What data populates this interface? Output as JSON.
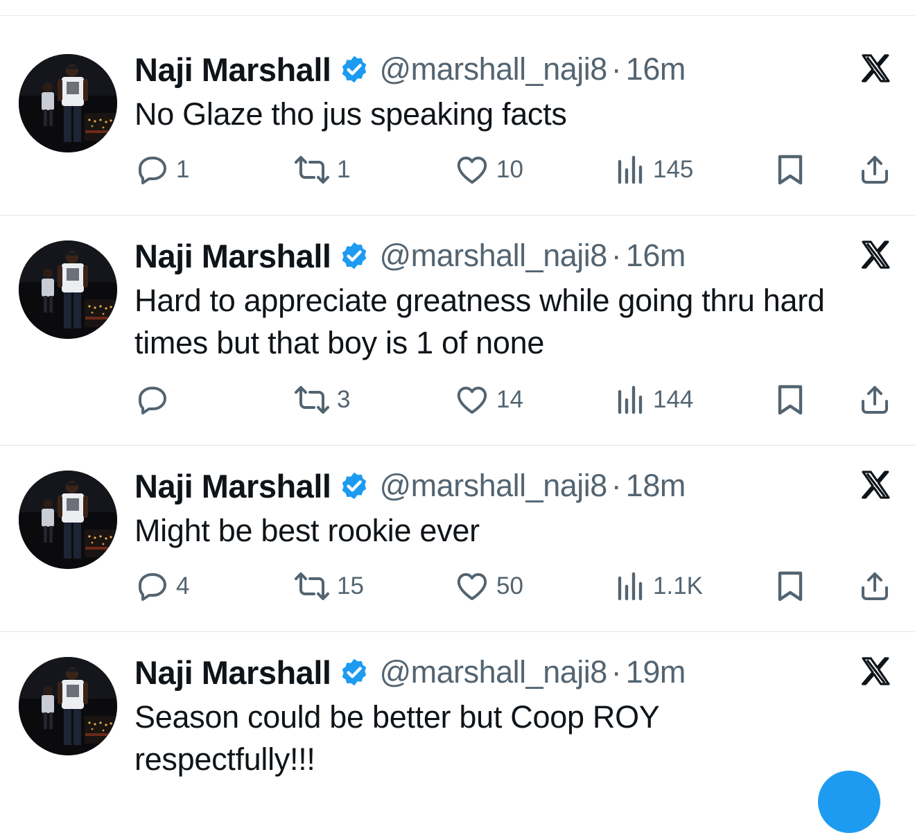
{
  "colors": {
    "accent": "#1d9bf0",
    "text": "#0f1419",
    "muted": "#536471",
    "divider": "#e1e5e8"
  },
  "icons": {
    "verified": "verified-badge-icon",
    "brand": "x-logo-icon",
    "reply": "reply-icon",
    "repost": "repost-icon",
    "like": "heart-icon",
    "views": "views-icon",
    "bookmark": "bookmark-icon",
    "share": "share-icon"
  },
  "tweets": [
    {
      "name": "Naji Marshall",
      "handle": "@marshall_naji8",
      "separator": "·",
      "time": "16m",
      "text": "No Glaze tho jus speaking facts",
      "replies": "1",
      "reposts": "1",
      "likes": "10",
      "views": "145"
    },
    {
      "name": "Naji Marshall",
      "handle": "@marshall_naji8",
      "separator": "·",
      "time": "16m",
      "text": "Hard to appreciate greatness while going thru hard times but that boy is 1 of none",
      "replies": "",
      "reposts": "3",
      "likes": "14",
      "views": "144"
    },
    {
      "name": "Naji Marshall",
      "handle": "@marshall_naji8",
      "separator": "·",
      "time": "18m",
      "text": "Might be best rookie ever",
      "replies": "4",
      "reposts": "15",
      "likes": "50",
      "views": "1.1K"
    },
    {
      "name": "Naji Marshall",
      "handle": "@marshall_naji8",
      "separator": "·",
      "time": "19m",
      "text": "Season could be better but Coop ROY respectfully!!!",
      "replies": "",
      "reposts": "",
      "likes": "",
      "views": ""
    }
  ]
}
